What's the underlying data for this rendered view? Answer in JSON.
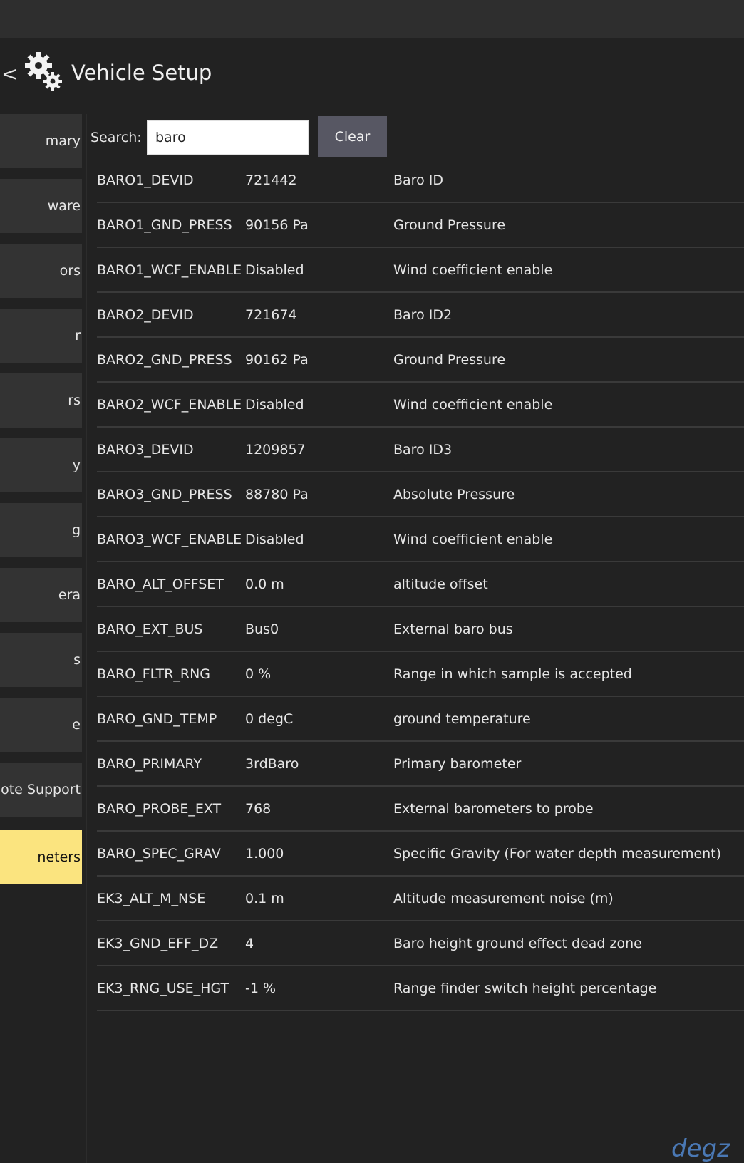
{
  "header": {
    "title": "Vehicle Setup",
    "back_label": "<"
  },
  "sidebar": {
    "items": [
      {
        "label": "mary"
      },
      {
        "label": "ware"
      },
      {
        "label": "ors"
      },
      {
        "label": "r"
      },
      {
        "label": "rs"
      },
      {
        "label": "y"
      },
      {
        "label": "g"
      },
      {
        "label": "era"
      },
      {
        "label": "s"
      },
      {
        "label": "e"
      },
      {
        "label": "ote Support"
      },
      {
        "label": "neters",
        "active": true
      }
    ]
  },
  "search": {
    "label": "Search:",
    "value": "baro",
    "clear_label": "Clear"
  },
  "params": [
    {
      "name": "BARO1_DEVID",
      "value": "721442",
      "desc": "Baro ID"
    },
    {
      "name": "BARO1_GND_PRESS",
      "value": "90156 Pa",
      "desc": "Ground Pressure"
    },
    {
      "name": "BARO1_WCF_ENABLE",
      "value": "Disabled",
      "desc": "Wind coefficient enable"
    },
    {
      "name": "BARO2_DEVID",
      "value": "721674",
      "desc": "Baro ID2"
    },
    {
      "name": "BARO2_GND_PRESS",
      "value": "90162 Pa",
      "desc": "Ground Pressure"
    },
    {
      "name": "BARO2_WCF_ENABLE",
      "value": "Disabled",
      "desc": "Wind coefficient enable"
    },
    {
      "name": "BARO3_DEVID",
      "value": "1209857",
      "desc": "Baro ID3"
    },
    {
      "name": "BARO3_GND_PRESS",
      "value": "88780 Pa",
      "desc": "Absolute Pressure"
    },
    {
      "name": "BARO3_WCF_ENABLE",
      "value": "Disabled",
      "desc": "Wind coefficient enable"
    },
    {
      "name": "BARO_ALT_OFFSET",
      "value": "0.0 m",
      "desc": "altitude offset"
    },
    {
      "name": "BARO_EXT_BUS",
      "value": "Bus0",
      "desc": "External baro bus"
    },
    {
      "name": "BARO_FLTR_RNG",
      "value": "0 %",
      "desc": "Range in which sample is accepted"
    },
    {
      "name": "BARO_GND_TEMP",
      "value": "0 degC",
      "desc": "ground temperature"
    },
    {
      "name": "BARO_PRIMARY",
      "value": "3rdBaro",
      "desc": "Primary barometer"
    },
    {
      "name": "BARO_PROBE_EXT",
      "value": "768",
      "desc": "External barometers to probe"
    },
    {
      "name": "BARO_SPEC_GRAV",
      "value": "1.000",
      "desc": "Specific Gravity (For water depth measurement)"
    },
    {
      "name": "EK3_ALT_M_NSE",
      "value": "0.1 m",
      "desc": "Altitude measurement noise (m)"
    },
    {
      "name": "EK3_GND_EFF_DZ",
      "value": "4",
      "desc": "Baro height ground effect dead zone"
    },
    {
      "name": "EK3_RNG_USE_HGT",
      "value": "-1 %",
      "desc": "Range finder switch height percentage"
    }
  ],
  "watermark": "degz",
  "colors": {
    "active_item": "#fbe47f",
    "button": "#575763",
    "background": "#222222"
  },
  "icons": {
    "header": "gears-icon"
  }
}
